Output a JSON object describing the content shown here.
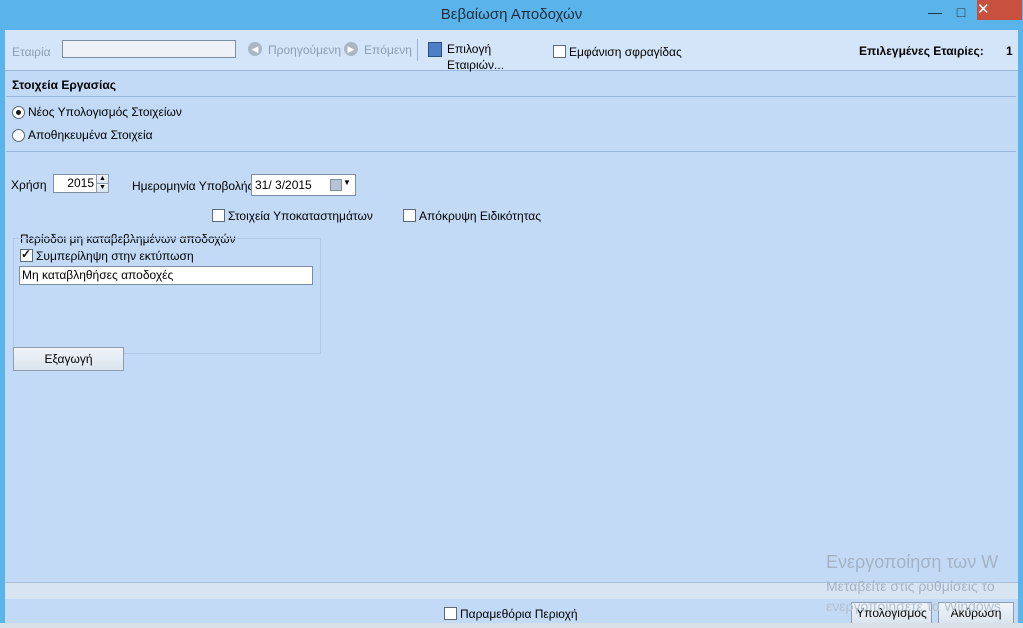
{
  "window": {
    "title": "Βεβαίωση Αποδοχών",
    "minimize": "—",
    "maximize": "□",
    "close": "✕"
  },
  "toolbar": {
    "company_label": "Εταιρία",
    "company_value": "",
    "previous_label": "Προηγούμενη",
    "next_label": "Επόμενη",
    "select_companies_label": "Επιλογή Εταιριών...",
    "show_seal_label": "Εμφάνιση σφραγίδας",
    "selected_companies_label": "Επιλεγμένες Εταιρίες:",
    "selected_companies_count": "1"
  },
  "section": {
    "title": "Στοιχεία Εργασίας",
    "radio_new": "Νέος Υπολογισμός Στοιχείων",
    "radio_saved": "Αποθηκευμένα Στοιχεία",
    "radio_selected": "new"
  },
  "form": {
    "year_label": "Χρήση",
    "year_value": "2015",
    "submission_date_label": "Ημερομηνία Υποβολής",
    "submission_date_value": "31/ 3/2015",
    "branches_label": "Στοιχεία Υποκαταστημάτων",
    "hide_specialty_label": "Απόκρυψη Ειδικότητας"
  },
  "unpaid": {
    "group_label": "Περίοδοι μη καταβεβλημένων αποδοχών",
    "include_label": "Συμπερίληψη στην εκτύπωση",
    "include_checked": true,
    "text_value": "Μη καταβληθήσες αποδοχές"
  },
  "buttons": {
    "export": "Εξαγωγή",
    "calculate": "Υπολογισμός",
    "cancel": "Ακύρωση"
  },
  "footer": {
    "parameter_area_label": "Παραμεθόρια Περιοχή"
  },
  "watermark": {
    "line1": "Ενεργοποίηση των W",
    "line2": "Μεταβείτε στις ρυθμίσεις το",
    "line3": "ενεργοποίησετε τα Windows"
  }
}
